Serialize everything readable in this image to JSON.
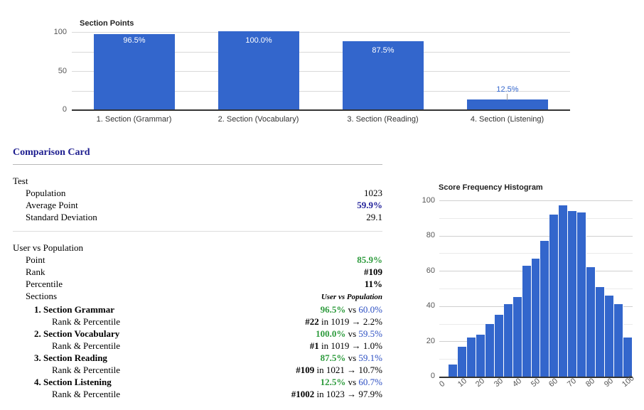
{
  "accent_blue": "#3366cc",
  "green": "#2e9b3d",
  "navy": "#1d1d8f",
  "section_points_chart": {
    "title": "Section Points"
  },
  "comparison_card": {
    "heading": "Comparison Card",
    "test_group": {
      "label": "Test",
      "rows": [
        {
          "label": "Population",
          "value": "1023"
        },
        {
          "label": "Average Point",
          "value": "59.9%"
        },
        {
          "label": "Standard Deviation",
          "value": "29.1"
        }
      ]
    },
    "user_group": {
      "label": "User vs Population",
      "point_label": "Point",
      "point_value": "85.9%",
      "rank_label": "Rank",
      "rank_value": "#109",
      "percentile_label": "Percentile",
      "percentile_value": "11%",
      "sections_label": "Sections",
      "sections_header": "User vs Population",
      "sections": [
        {
          "name": "1. Section Grammar",
          "user": "96.5%",
          "vs": "vs",
          "population": "60.0%",
          "rank_label": "Rank & Percentile",
          "rank": "#22",
          "in": "in",
          "total": "1019",
          "arrow": "→",
          "percentile": "2.2%"
        },
        {
          "name": "2. Section Vocabulary",
          "user": "100.0%",
          "vs": "vs",
          "population": "59.5%",
          "rank_label": "Rank & Percentile",
          "rank": "#1",
          "in": "in",
          "total": "1019",
          "arrow": "→",
          "percentile": "1.0%"
        },
        {
          "name": "3. Section Reading",
          "user": "87.5%",
          "vs": "vs",
          "population": "59.1%",
          "rank_label": "Rank & Percentile",
          "rank": "#109",
          "in": "in",
          "total": "1021",
          "arrow": "→",
          "percentile": "10.7%"
        },
        {
          "name": "4. Section Listening",
          "user": "12.5%",
          "vs": "vs",
          "population": "60.7%",
          "rank_label": "Rank & Percentile",
          "rank": "#1002",
          "in": "in",
          "total": "1023",
          "arrow": "→",
          "percentile": "97.9%"
        }
      ]
    }
  },
  "chart_data": [
    {
      "type": "bar",
      "title": "Section Points",
      "xlabel": "",
      "ylabel": "",
      "ylim": [
        0,
        100
      ],
      "yticks": [
        0,
        50,
        100
      ],
      "ytick_labels": [
        "0",
        "50",
        "100"
      ],
      "gridlines": [
        0,
        25,
        50,
        75,
        100
      ],
      "grid": true,
      "legend": false,
      "bar_color": "#3366cc",
      "categories": [
        "1. Section (Grammar)",
        "2. Section (Vocabulary)",
        "3. Section (Reading)",
        "4. Section (Listening)"
      ],
      "values": [
        96.5,
        100.0,
        87.5,
        12.5
      ],
      "data_labels": [
        "96.5%",
        "100.0%",
        "87.5%",
        "12.5%"
      ],
      "data_label_position": [
        "inside",
        "inside",
        "inside",
        "outside"
      ]
    },
    {
      "type": "bar",
      "title": "Score Frequency Histogram",
      "xlabel": "",
      "ylabel": "",
      "ylim": [
        0,
        100
      ],
      "yticks": [
        0,
        20,
        40,
        60,
        80,
        100
      ],
      "ytick_labels": [
        "0",
        "20",
        "40",
        "60",
        "80",
        "100"
      ],
      "xtick_labels": [
        "0",
        "10",
        "20",
        "30",
        "40",
        "50",
        "60",
        "70",
        "80",
        "90",
        "100"
      ],
      "grid": true,
      "legend": false,
      "bar_color": "#3366cc",
      "bin_centers": [
        2.5,
        7.5,
        12.5,
        17.5,
        22.5,
        27.5,
        32.5,
        37.5,
        42.5,
        47.5,
        52.5,
        57.5,
        62.5,
        67.5,
        72.5,
        77.5,
        82.5,
        87.5,
        92.5,
        97.5
      ],
      "values": [
        0,
        7,
        17,
        22,
        24,
        30,
        35,
        41,
        45,
        63,
        67,
        77,
        92,
        97,
        94,
        93,
        62,
        51,
        46,
        41,
        22
      ]
    }
  ]
}
